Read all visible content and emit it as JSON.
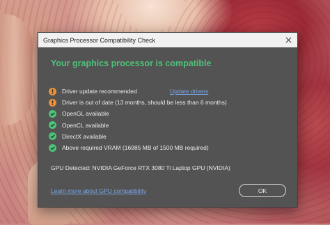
{
  "dialog": {
    "title": "Graphics Processor Compatibility Check",
    "heading": "Your graphics processor is compatible",
    "checks": [
      {
        "status": "warning",
        "text": "Driver update recommended",
        "link": "Update drivers"
      },
      {
        "status": "warning",
        "text": "Driver is out of date (13 months, should be less than 6 months)"
      },
      {
        "status": "ok",
        "text": "OpenGL available"
      },
      {
        "status": "ok",
        "text": "OpenCL available"
      },
      {
        "status": "ok",
        "text": "DirectX available"
      },
      {
        "status": "ok",
        "text": "Above required VRAM (16985 MB of 1500 MB required)"
      }
    ],
    "gpu_detected": "GPU Detected: NVIDIA GeForce RTX 3080 Ti Laptop GPU (NVIDIA)",
    "learn_more": "Learn more about GPU compatibility",
    "ok_label": "OK"
  },
  "colors": {
    "heading": "#4fc27a",
    "warning": "#e8923a",
    "ok": "#4fc27a",
    "link": "#7aa6e6",
    "dialog_bg": "#535353"
  },
  "icons": {
    "warning": "warning-icon",
    "ok": "check-circle-icon",
    "close": "close-icon"
  }
}
